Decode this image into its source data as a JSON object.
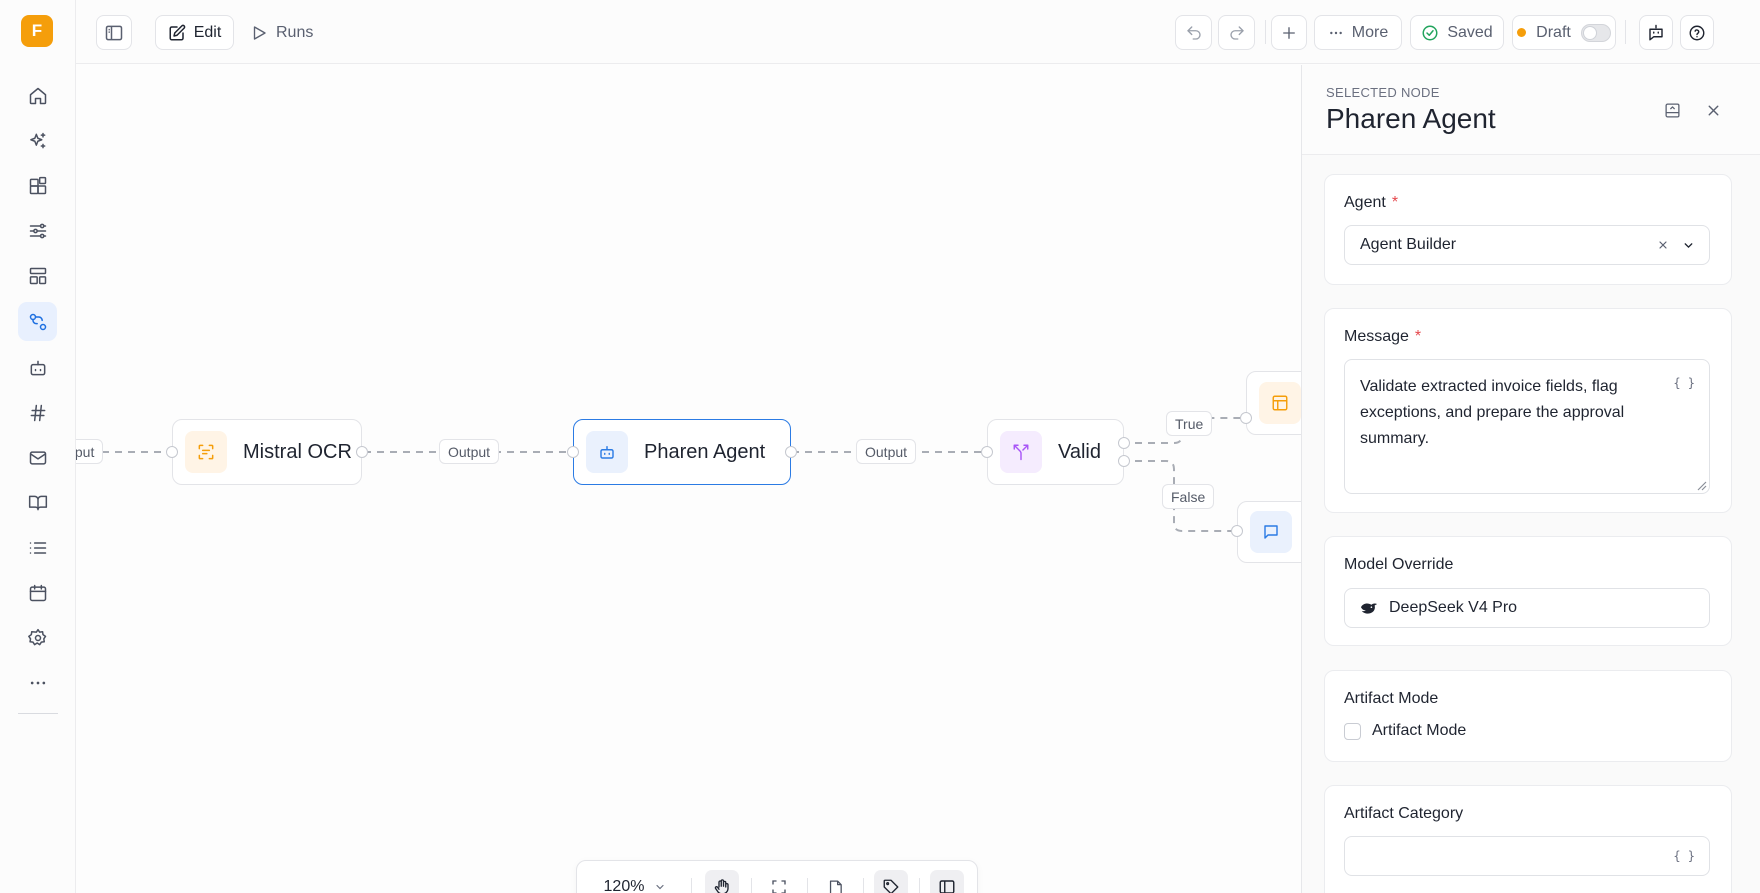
{
  "app": {
    "logo_letter": "F"
  },
  "topbar": {
    "edit_label": "Edit",
    "runs_label": "Runs",
    "more_label": "More",
    "saved_label": "Saved",
    "draft_label": "Draft"
  },
  "canvas": {
    "nodes": [
      {
        "title": "Mistral OCR",
        "icon": "ocr-scan-icon",
        "accent": "#f59e0b"
      },
      {
        "title": "Pharen Agent",
        "icon": "bot-icon",
        "accent": "#2b7be4"
      },
      {
        "title": "Valid",
        "icon": "split-branch-icon",
        "accent": "#a855f7"
      }
    ],
    "edge_labels": {
      "partial_output": "tput",
      "output_1": "Output",
      "output_2": "Output",
      "true_branch": "True",
      "false_branch": "False"
    }
  },
  "zoombar": {
    "zoom": "120%"
  },
  "panel": {
    "eyebrow": "SELECTED NODE",
    "title": "Pharen Agent",
    "agent": {
      "label": "Agent",
      "required_mark": "*",
      "value": "Agent Builder"
    },
    "message": {
      "label": "Message",
      "required_mark": "*",
      "value": "Validate extracted invoice fields, flag exceptions, and prepare the approval summary.",
      "var_button": "{ }"
    },
    "model_override": {
      "label": "Model Override",
      "value": "DeepSeek V4 Pro"
    },
    "artifact_mode": {
      "label": "Artifact Mode",
      "checkbox_label": "Artifact Mode",
      "checked": false
    },
    "artifact_category": {
      "label": "Artifact Category",
      "value": "",
      "var_button": "{ }"
    }
  },
  "colors": {
    "accent": "#2b7be4",
    "brand": "#f59e0b",
    "draft": "#f59e0b",
    "saved": "#22a45d"
  }
}
